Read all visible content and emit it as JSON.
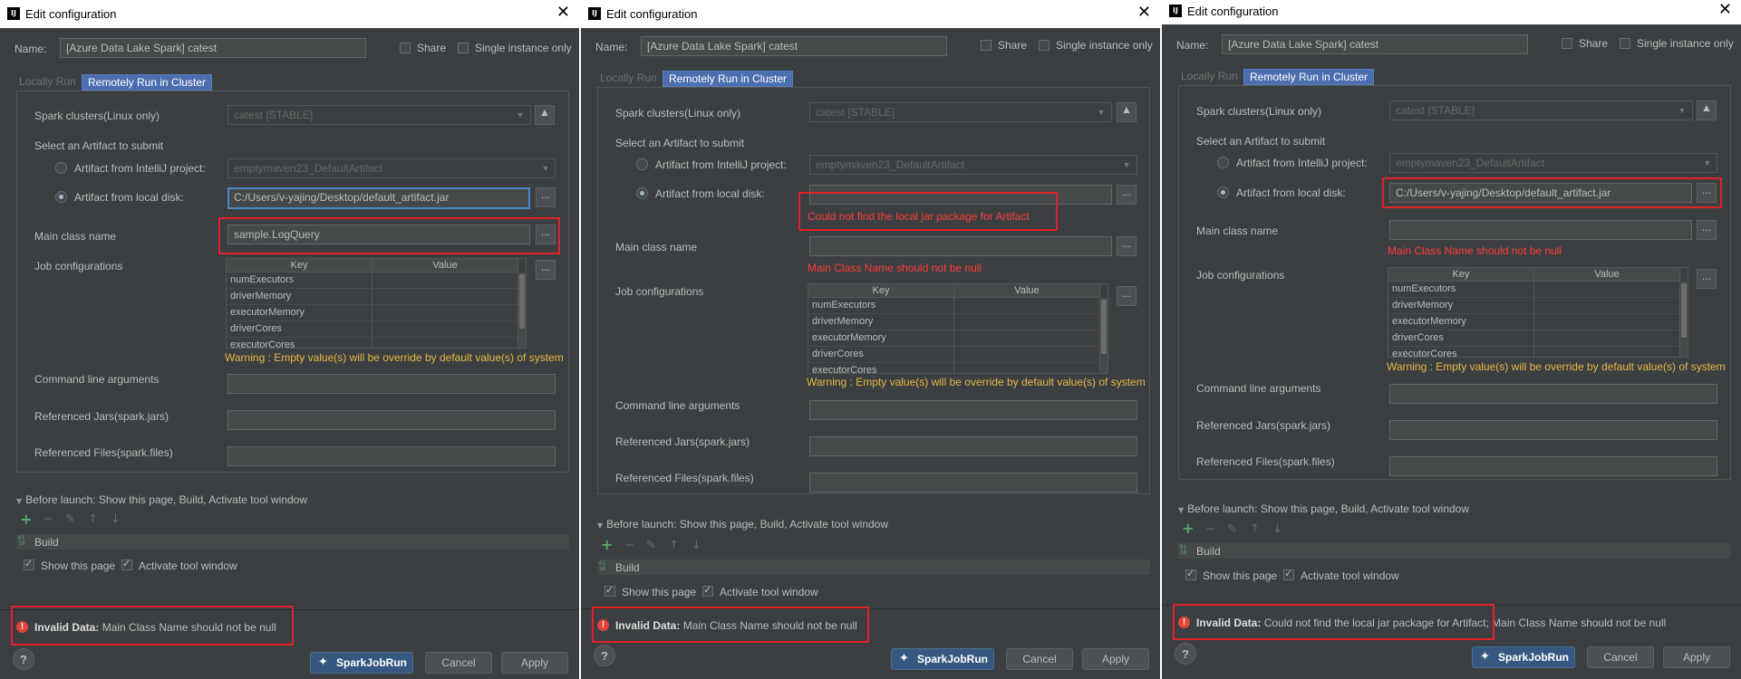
{
  "dialogs": [
    {
      "title": "Edit configuration",
      "name_label": "Name:",
      "name_value": "[Azure Data Lake Spark] catest",
      "share_label": "Share",
      "single_instance_label": "Single instance only",
      "tab_locally": "Locally Run",
      "tab_remote": "Remotely Run in Cluster",
      "spark_clusters_label": "Spark clusters(Linux only)",
      "cluster_value": "catest [STABLE]",
      "select_artifact_label": "Select an Artifact to submit",
      "artifact_intellij_label": "Artifact from IntelliJ project:",
      "artifact_intellij_value": "emptymaven23_DefaultArtifact",
      "artifact_local_label": "Artifact from local disk:",
      "artifact_local_value": "C:/Users/v-yajing/Desktop/default_artifact.jar",
      "main_class_label": "Main class name",
      "main_class_value": "sample.LogQuery",
      "job_config_label": "Job configurations",
      "col_key": "Key",
      "col_value": "Value",
      "rows": [
        "numExecutors",
        "driverMemory",
        "executorMemory",
        "driverCores",
        "executorCores"
      ],
      "warning": "Warning : Empty value(s) will be override by default value(s) of system",
      "cmd_args_label": "Command line arguments",
      "ref_jars_label": "Referenced Jars(spark.jars)",
      "ref_files_label": "Referenced Files(spark.files)",
      "before_launch": "Before launch: Show this page, Build, Activate tool window",
      "build_label": "Build",
      "show_page_label": "Show this page",
      "activate_tool_label": "Activate tool window",
      "invalid_bold": "Invalid Data:",
      "invalid_msg": " Main Class Name should not be null",
      "run_button": "SparkJobRun",
      "cancel_button": "Cancel",
      "apply_button": "Apply",
      "help": "?"
    },
    {
      "title": "Edit configuration",
      "name_label": "Name:",
      "name_value": "[Azure Data Lake Spark] catest",
      "share_label": "Share",
      "single_instance_label": "Single instance only",
      "tab_locally": "Locally Run",
      "tab_remote": "Remotely Run in Cluster",
      "spark_clusters_label": "Spark clusters(Linux only)",
      "cluster_value": "catest [STABLE]",
      "select_artifact_label": "Select an Artifact to submit",
      "artifact_intellij_label": "Artifact from IntelliJ project:",
      "artifact_intellij_value": "emptymaven23_DefaultArtifact",
      "artifact_local_label": "Artifact from local disk:",
      "artifact_local_value": "",
      "artifact_error": "Could not find the local jar package for Artifact",
      "main_class_label": "Main class name",
      "main_class_value": "",
      "main_class_error": "Main Class Name should not be null",
      "job_config_label": "Job configurations",
      "col_key": "Key",
      "col_value": "Value",
      "rows": [
        "numExecutors",
        "driverMemory",
        "executorMemory",
        "driverCores",
        "executorCores"
      ],
      "warning": "Warning : Empty value(s) will be override by default value(s) of system",
      "cmd_args_label": "Command line arguments",
      "ref_jars_label": "Referenced Jars(spark.jars)",
      "ref_files_label": "Referenced Files(spark.files)",
      "before_launch": "Before launch: Show this page, Build, Activate tool window",
      "build_label": "Build",
      "show_page_label": "Show this page",
      "activate_tool_label": "Activate tool window",
      "invalid_bold": "Invalid Data:",
      "invalid_msg": " Main Class Name should not be null",
      "run_button": "SparkJobRun",
      "cancel_button": "Cancel",
      "apply_button": "Apply",
      "help": "?"
    },
    {
      "title": "Edit configuration",
      "name_label": "Name:",
      "name_value": "[Azure Data Lake Spark] catest",
      "share_label": "Share",
      "single_instance_label": "Single instance only",
      "tab_locally": "Locally Run",
      "tab_remote": "Remotely Run in Cluster",
      "spark_clusters_label": "Spark clusters(Linux only)",
      "cluster_value": "catest [STABLE]",
      "select_artifact_label": "Select an Artifact to submit",
      "artifact_intellij_label": "Artifact from IntelliJ project:",
      "artifact_intellij_value": "emptymaven23_DefaultArtifact",
      "artifact_local_label": "Artifact from local disk:",
      "artifact_local_value": "C:/Users/v-yajing/Desktop/default_artifact.jar",
      "main_class_label": "Main class name",
      "main_class_value": "",
      "main_class_error": "Main Class Name should not be null",
      "job_config_label": "Job configurations",
      "col_key": "Key",
      "col_value": "Value",
      "rows": [
        "numExecutors",
        "driverMemory",
        "executorMemory",
        "driverCores",
        "executorCores"
      ],
      "warning": "Warning : Empty value(s) will be override by default value(s) of system",
      "cmd_args_label": "Command line arguments",
      "ref_jars_label": "Referenced Jars(spark.jars)",
      "ref_files_label": "Referenced Files(spark.files)",
      "before_launch": "Before launch: Show this page, Build, Activate tool window",
      "build_label": "Build",
      "show_page_label": "Show this page",
      "activate_tool_label": "Activate tool window",
      "invalid_bold": "Invalid Data:",
      "invalid_msg": " Could not find the local jar package for Artifact; Main Class Name should not be null",
      "run_button": "SparkJobRun",
      "cancel_button": "Cancel",
      "apply_button": "Apply",
      "help": "?"
    }
  ],
  "colors": {
    "background": "#3c3f41",
    "error_text": "#ff3c3c",
    "warning_text": "#e5b743",
    "highlight_box": "#e0222a",
    "primary_button": "#365880"
  }
}
